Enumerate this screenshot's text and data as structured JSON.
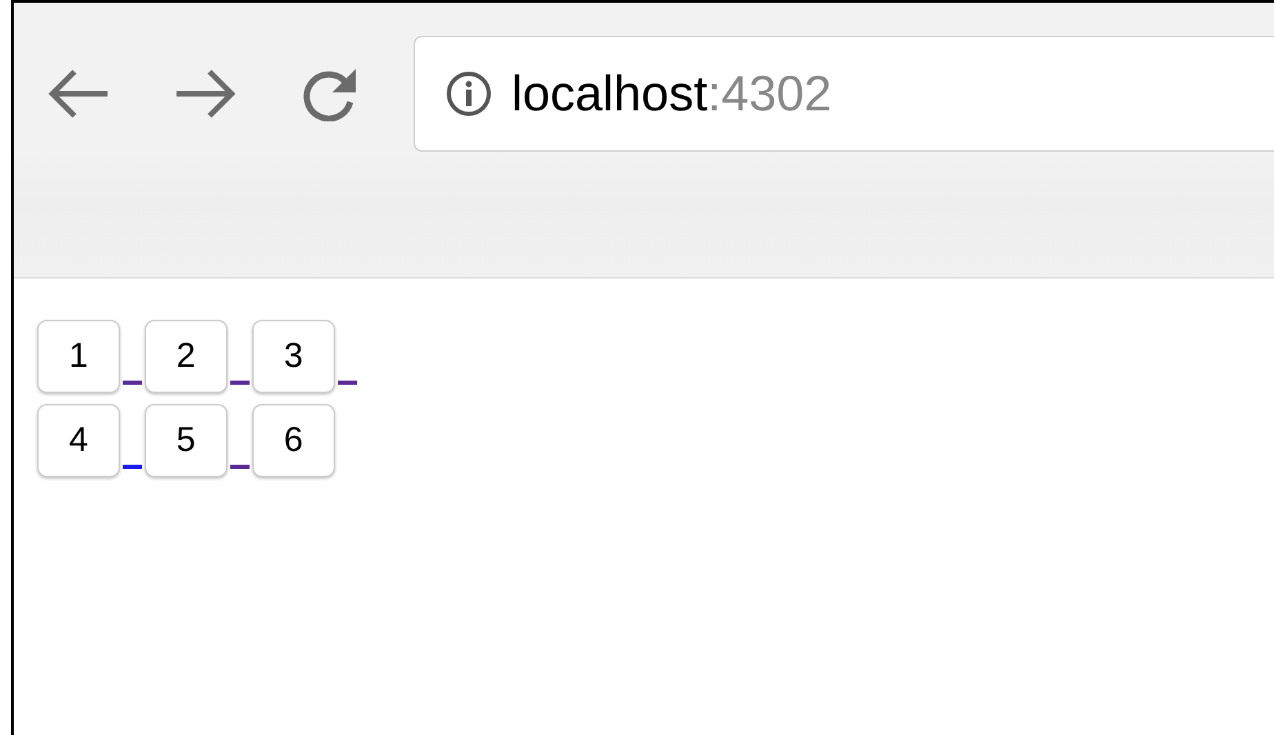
{
  "address_bar": {
    "host": "localhost",
    "port": ":4302"
  },
  "button_rows": [
    {
      "buttons": [
        {
          "label": "1",
          "trailing_link": {
            "visited": true
          }
        },
        {
          "label": "2",
          "trailing_link": {
            "visited": true
          }
        },
        {
          "label": "3",
          "trailing_link": {
            "visited": true
          }
        }
      ]
    },
    {
      "buttons": [
        {
          "label": "4",
          "trailing_link": {
            "visited": false
          }
        },
        {
          "label": "5",
          "trailing_link": {
            "visited": true
          }
        },
        {
          "label": "6"
        }
      ]
    }
  ]
}
